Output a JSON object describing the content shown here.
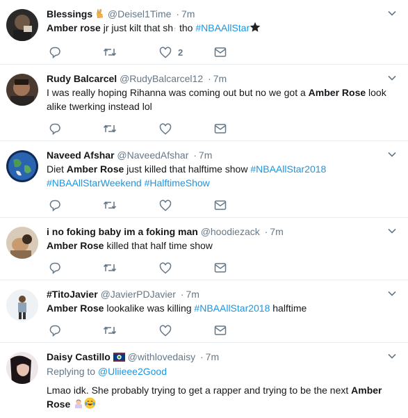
{
  "tweets": [
    {
      "name": "Blessings",
      "name_emoji": "victory-hand-emoji",
      "handle": "@Deisel1Time",
      "dot": "·",
      "time": "7m",
      "text_parts": [
        {
          "t": "Amber rose",
          "b": true
        },
        {
          "t": " jr just kilt that sh",
          "b": false
        },
        {
          "t": "↑",
          "b": false
        },
        {
          "t": " tho ",
          "b": false
        }
      ],
      "hashtags": [
        "#NBAAllStar"
      ],
      "like_count": "2"
    },
    {
      "name": "Rudy Balcarcel",
      "handle": "@RudyBalcarcel12",
      "dot": "·",
      "time": "7m",
      "line1_pre": "I was really hoping Rihanna was coming out but no we got a ",
      "line1_bold": "Amber Rose",
      "line1_post": " look",
      "line2": "alike twerking instead lol",
      "like_count": ""
    },
    {
      "name": "Naveed Afshar",
      "handle": "@NaveedAfshar",
      "dot": "·",
      "time": "7m",
      "line1_pre": "Diet ",
      "line1_bold": "Amber Rose",
      "line1_post": " just killed that halftime show ",
      "line1_tag": "#NBAAllStar2018",
      "line2_tags": [
        "#NBAAllStarWeekend",
        "#HalftimeShow"
      ],
      "like_count": ""
    },
    {
      "name": "i no foking baby im a foking man",
      "handle": "@hoodiezack",
      "dot": "·",
      "time": "7m",
      "line1_bold": "Amber Rose",
      "line1_post": " killed that half time show",
      "like_count": ""
    },
    {
      "name": "#TitoJavier",
      "handle": "@JavierPDJavier",
      "dot": "·",
      "time": "7m",
      "line1_bold": "Amber Rose",
      "line1_post": " lookalike was killing ",
      "line1_tag": "#NBAAllStar2018",
      "line1_tail": " halftime",
      "like_count": ""
    },
    {
      "name": "Daisy Castillo",
      "name_emoji": "belize-flag-emoji",
      "handle": "@withlovedaisy",
      "dot": "·",
      "time": "7m",
      "replying_label": "Replying to ",
      "replying_to": "@Uliieee2Good",
      "line1_pre": "Lmao idk. She probably trying to get a rapper and trying to be the next ",
      "line1_bold": "Amber",
      "line2_bold": "Rose",
      "line2_emojis": [
        "woman-tipping-hand-emoji",
        "tears-of-joy-emoji"
      ],
      "like_count": ""
    }
  ],
  "colors": {
    "link": "#1b95e0",
    "secondary": "#657786",
    "icon": "#657786",
    "divider": "#e6ecf0",
    "text": "#14171a"
  },
  "icons": {
    "reply": "reply-icon",
    "retweet": "retweet-icon",
    "like": "heart-icon",
    "dm": "envelope-icon",
    "caret": "chevron-down-icon",
    "star": "star-icon"
  }
}
